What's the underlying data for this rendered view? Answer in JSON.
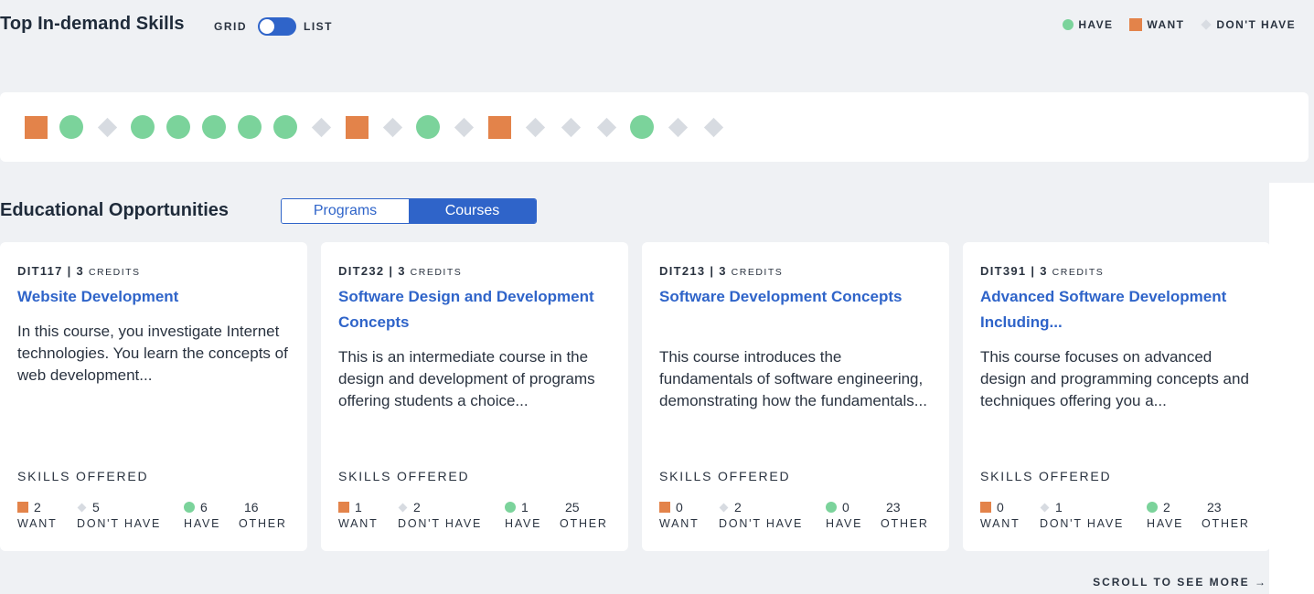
{
  "header": {
    "title": "Top In-demand Skills",
    "toggle_grid": "GRID",
    "toggle_list": "LIST",
    "legend": {
      "have": "HAVE",
      "want": "WANT",
      "dont_have": "DON'T HAVE"
    }
  },
  "colors": {
    "accent": "#2f64c9",
    "have": "#7bd39b",
    "want": "#e3834a",
    "dont_have": "#d7dbe1"
  },
  "skills": [
    "want",
    "have",
    "dont",
    "have",
    "have",
    "have",
    "have",
    "have",
    "dont",
    "want",
    "dont",
    "have",
    "dont",
    "want",
    "dont",
    "dont",
    "dont",
    "have",
    "dont",
    "dont"
  ],
  "education": {
    "title": "Educational Opportunities",
    "tab_programs": "Programs",
    "tab_courses": "Courses",
    "selected_tab": "Courses"
  },
  "cards": [
    {
      "code": "DIT117 | 3",
      "credits_word": "CREDITS",
      "title": "Website Development",
      "desc": "In this course, you investigate Internet technologies. You learn the concepts of web development...",
      "skills_label": "SKILLS OFFERED",
      "want": "2",
      "dont_have": "5",
      "have": "6",
      "other": "16",
      "want_lbl": "WANT",
      "dont_lbl": "DON'T HAVE",
      "have_lbl": "HAVE",
      "other_lbl": "OTHER"
    },
    {
      "code": "DIT232 | 3",
      "credits_word": "CREDITS",
      "title": "Software Design and Development Concepts",
      "desc": "This is an intermediate course in the design and development of programs offering students a choice...",
      "skills_label": "SKILLS OFFERED",
      "want": "1",
      "dont_have": "2",
      "have": "1",
      "other": "25",
      "want_lbl": "WANT",
      "dont_lbl": "DON'T HAVE",
      "have_lbl": "HAVE",
      "other_lbl": "OTHER"
    },
    {
      "code": "DIT213 | 3",
      "credits_word": "CREDITS",
      "title": "Software Development Concepts",
      "desc": "This course introduces the fundamentals of software engineering, demonstrating how the fundamentals...",
      "skills_label": "SKILLS OFFERED",
      "want": "0",
      "dont_have": "2",
      "have": "0",
      "other": "23",
      "want_lbl": "WANT",
      "dont_lbl": "DON'T HAVE",
      "have_lbl": "HAVE",
      "other_lbl": "OTHER"
    },
    {
      "code": "DIT391 | 3",
      "credits_word": "CREDITS",
      "title": "Advanced Software Development Including...",
      "desc": "This course focuses on advanced design and programming concepts and techniques offering you a...",
      "skills_label": "SKILLS OFFERED",
      "want": "0",
      "dont_have": "1",
      "have": "2",
      "other": "23",
      "want_lbl": "WANT",
      "dont_lbl": "DON'T HAVE",
      "have_lbl": "HAVE",
      "other_lbl": "OTHER"
    }
  ],
  "scroll_hint": "SCROLL TO SEE MORE →"
}
